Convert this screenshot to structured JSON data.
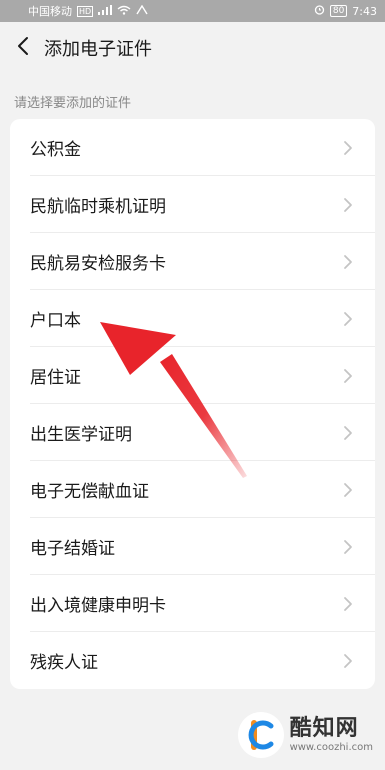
{
  "status_bar": {
    "carrier": "中国移动",
    "signal_badge": "HD",
    "battery": "80",
    "time": "7:43"
  },
  "header": {
    "title": "添加电子证件"
  },
  "section": {
    "label": "请选择要添加的证件"
  },
  "items": [
    {
      "label": "公积金"
    },
    {
      "label": "民航临时乘机证明"
    },
    {
      "label": "民航易安检服务卡"
    },
    {
      "label": "户口本"
    },
    {
      "label": "居住证"
    },
    {
      "label": "出生医学证明"
    },
    {
      "label": "电子无偿献血证"
    },
    {
      "label": "电子结婚证"
    },
    {
      "label": "出入境健康申明卡"
    },
    {
      "label": "残疾人证"
    }
  ],
  "annotation": {
    "arrow_color": "#e8242b"
  },
  "watermark": {
    "name": "酷知网",
    "url": "www.coozhi.com"
  },
  "colors": {
    "background": "#f2f2f2",
    "card": "#ffffff",
    "text": "#1a1a1a",
    "muted": "#888888",
    "chevron": "#c4c4c4"
  }
}
